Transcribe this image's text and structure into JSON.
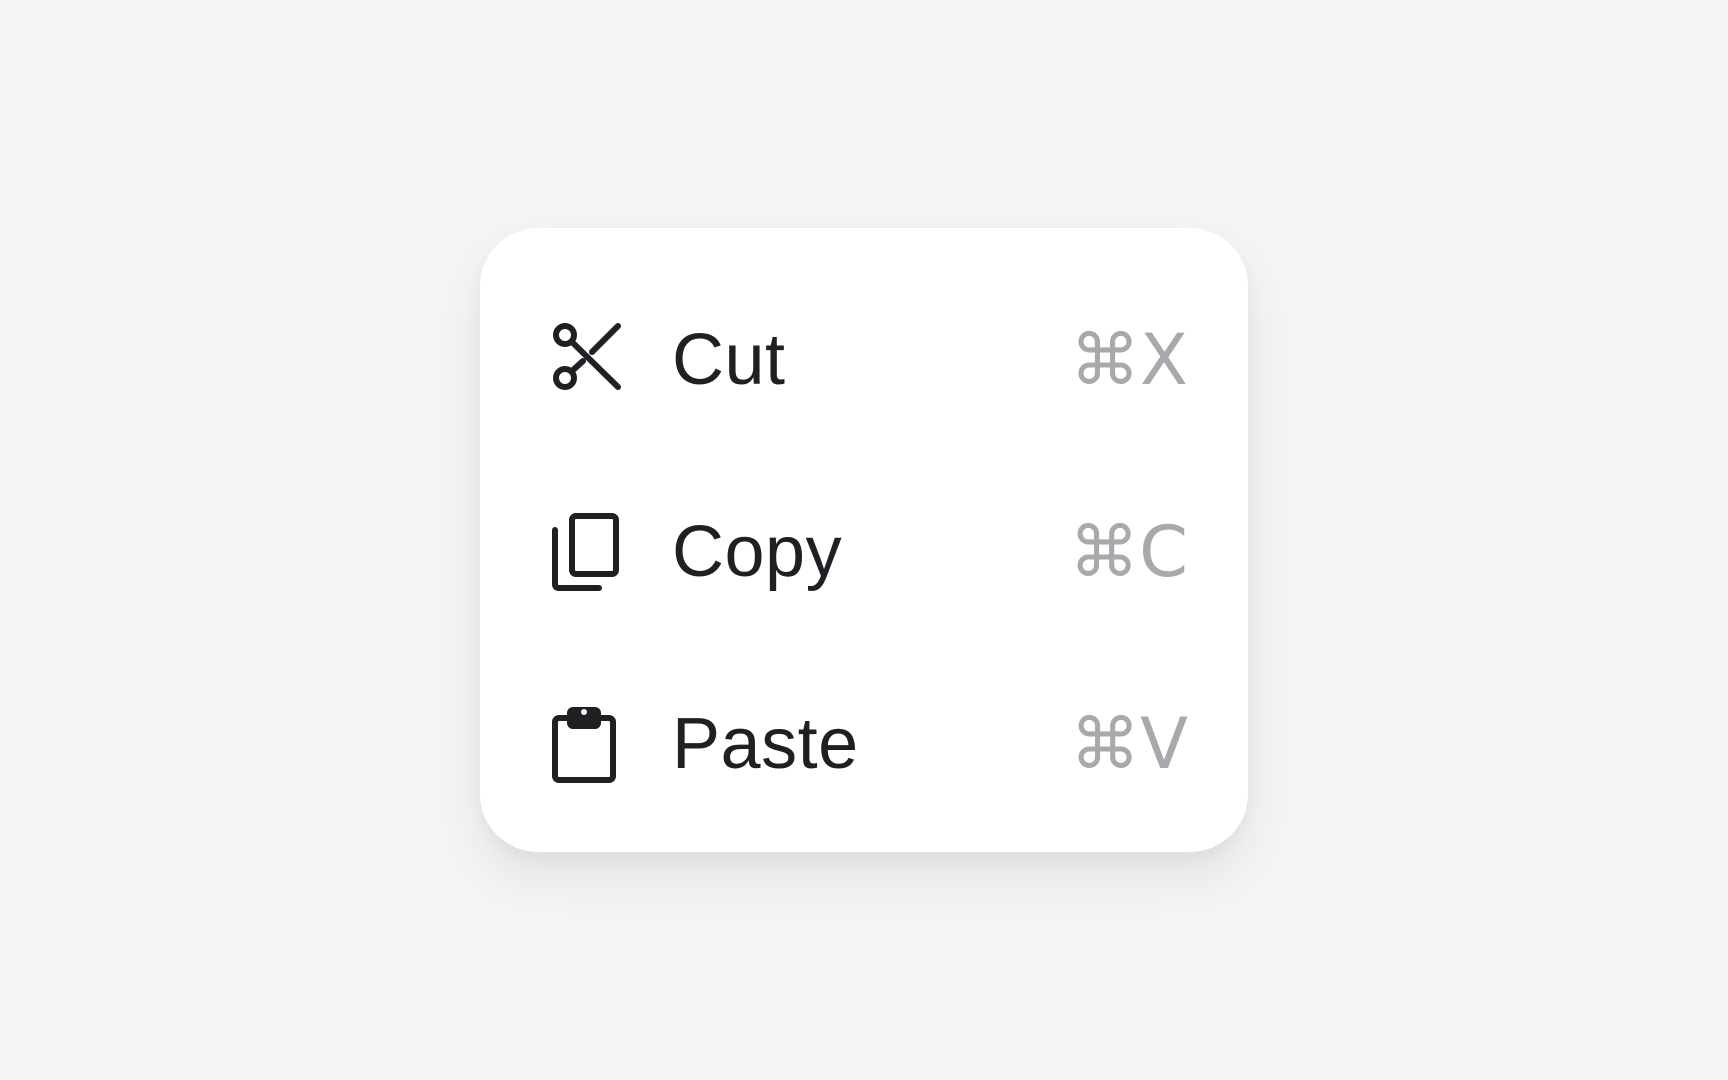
{
  "menu": {
    "items": [
      {
        "icon": "scissors-icon",
        "label": "Cut",
        "shortcut": "⌘X"
      },
      {
        "icon": "copy-icon",
        "label": "Copy",
        "shortcut": "⌘C"
      },
      {
        "icon": "clipboard-icon",
        "label": "Paste",
        "shortcut": "⌘V"
      }
    ]
  },
  "colors": {
    "background": "#f4f4f4",
    "menu_background": "#ffffff",
    "label": "#1f1f24",
    "shortcut": "#a8a8ad"
  }
}
